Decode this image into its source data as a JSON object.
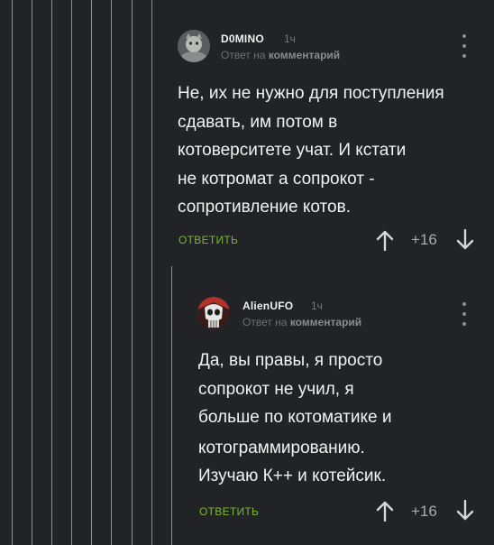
{
  "comments": [
    {
      "author": "D0MINO",
      "time": "1ч",
      "reply_prefix": "Ответ на",
      "reply_target": "комментарий",
      "text_lines": [
        "Не, их не нужно для поступления",
        "сдавать, им потом в",
        "котоверситете учат. И кстати",
        "не котромат а сопрокот -",
        "сопротивление котов."
      ],
      "reply_label": "ОТВЕТИТЬ",
      "rating": "+16"
    },
    {
      "author": "AlienUFO",
      "time": "1ч",
      "reply_prefix": "Ответ на",
      "reply_target": "комментарий",
      "text_lines": [
        "Да, вы правы, я просто",
        "сопрокот не учил, я",
        "больше по котоматике и",
        "котограммированию.",
        "Изучаю К++ и котейсик."
      ],
      "reply_label": "ОТВЕТИТЬ",
      "rating": "+16"
    }
  ],
  "icons": {
    "menu": "kebab-menu-icon",
    "upvote": "arrow-up-icon",
    "downvote": "arrow-down-icon"
  },
  "colors": {
    "background": "#222326",
    "thread_line": "#8e8f93",
    "reply_accent": "#7cb82f",
    "text": "#f2f2f2",
    "muted": "#6f7074"
  }
}
